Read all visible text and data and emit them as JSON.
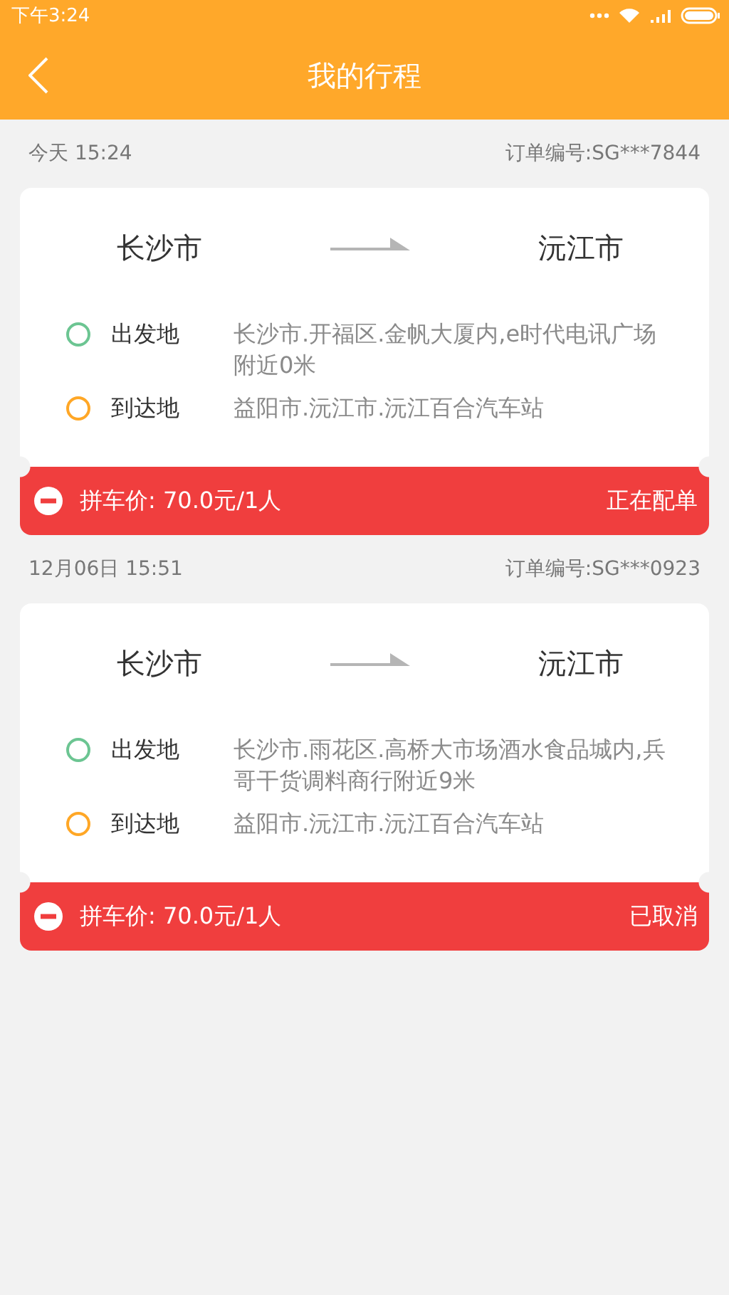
{
  "status_bar": {
    "time": "下午3:24"
  },
  "header": {
    "title": "我的行程"
  },
  "trips": [
    {
      "date": "今天 15:24",
      "order_no": "订单编号:SG***7844",
      "from_city": "长沙市",
      "to_city": "沅江市",
      "stops": [
        {
          "label": "出发地",
          "address": "长沙市.开福区.金帆大厦内,e时代电讯广场附近0米",
          "color": "#6cc592"
        },
        {
          "label": "到达地",
          "address": "益阳市.沅江市.沅江百合汽车站",
          "color": "#ffa726"
        }
      ],
      "price": "拼车价: 70.0元/1人",
      "status": "正在配单"
    },
    {
      "date": "12月06日 15:51",
      "order_no": "订单编号:SG***0923",
      "from_city": "长沙市",
      "to_city": "沅江市",
      "stops": [
        {
          "label": "出发地",
          "address": "长沙市.雨花区.高桥大市场酒水食品城内,兵哥干货调料商行附近9米",
          "color": "#6cc592"
        },
        {
          "label": "到达地",
          "address": "益阳市.沅江市.沅江百合汽车站",
          "color": "#ffa726"
        }
      ],
      "price": "拼车价: 70.0元/1人",
      "status": "已取消"
    }
  ]
}
